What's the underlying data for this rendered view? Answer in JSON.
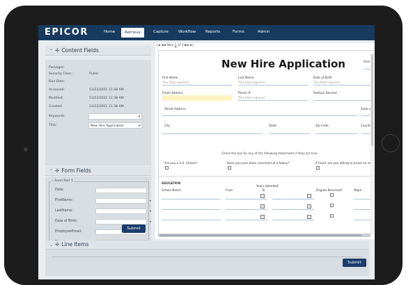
{
  "nav": {
    "logo": "EPICOR",
    "items": [
      {
        "label": "Home",
        "active": false
      },
      {
        "label": "Retrieve",
        "active": true
      },
      {
        "label": "Capture",
        "active": false
      },
      {
        "label": "Workflow",
        "active": false
      },
      {
        "label": "Reports",
        "active": false
      },
      {
        "label": "Forms",
        "active": false
      },
      {
        "label": "Admin",
        "active": false
      }
    ]
  },
  "content_fields": {
    "header": "Content Fields",
    "rows": [
      {
        "label": "Packages:",
        "value": ""
      },
      {
        "label": "Security Class:",
        "value": "Public"
      },
      {
        "label": "Due Date:",
        "value": ""
      },
      {
        "label": "Accessed:",
        "value": "12/22/2021 11:38 AM"
      },
      {
        "label": "Modified:",
        "value": "12/22/2021 11:38 AM"
      },
      {
        "label": "Created:",
        "value": "12/22/2021 11:38 AM"
      }
    ],
    "keywords_label": "Keywords:",
    "keywords_value": "",
    "title_label": "Title:",
    "title_value": "New Hire Application"
  },
  "form_fields": {
    "header": "Form Fields",
    "group_label": "Form Part 1",
    "fields": [
      {
        "label": "Date:",
        "value": "",
        "dropdown": false
      },
      {
        "label": "FirstName:",
        "value": "",
        "dropdown": true
      },
      {
        "label": "LastName:",
        "value": "",
        "dropdown": true
      },
      {
        "label": "Date of Birth:",
        "value": "",
        "dropdown": true
      },
      {
        "label": "EmployeeEmail:",
        "value": "",
        "dropdown": false
      },
      {
        "label": "Telephone:",
        "value": "",
        "dropdown": true
      }
    ],
    "submit_label": "Submit"
  },
  "doc": {
    "pager_prefix": "|◄ ◄◄ Item",
    "pager_page": "1",
    "pager_suffix": "of 1 ►► ►|",
    "title": "New Hire Application",
    "date_label": "Date",
    "first_name_label": "First Name",
    "first_name_hint": "This field required",
    "last_name_label": "Last Name",
    "last_name_hint": "This field required",
    "dob_label": "Date of Birth",
    "dob_hint": "This field required",
    "email_label": "Email Address",
    "phone_label": "Phone #",
    "phone_hint": "This field required",
    "position_label": "Position Desired",
    "street_label": "Street Address",
    "suite_label": "Suite or",
    "city_label": "City",
    "state_label": "State",
    "zip_label": "Zip Code",
    "country_label": "Country",
    "check_instructions": "Check the box for any of the following statements if they are true",
    "q_citizen": "Are you a U.S. Citizen?",
    "q_felony": "Have you ever been convicted of a felony?",
    "q_travel": "If hired, are you willing to travel on rele",
    "education_label": "EDUCATION",
    "school_label": "School Name",
    "years_label": "Years attended",
    "from_label": "From",
    "to_label": "To",
    "degree_label": "Degree Received?",
    "major_label": "Major"
  },
  "line_items": {
    "header": "Line Items",
    "submit_label": "Submit"
  }
}
